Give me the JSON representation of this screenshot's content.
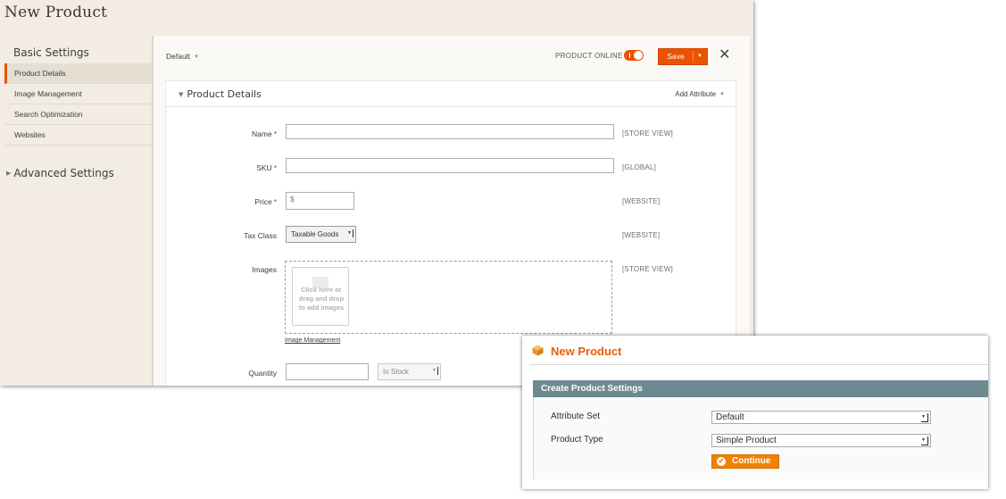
{
  "main": {
    "page_title": "New Product",
    "sidebar": {
      "basic_settings": "Basic Settings",
      "items": [
        "Product Details",
        "Image Management",
        "Search Optimization",
        "Websites"
      ],
      "advanced_settings": "Advanced Settings"
    },
    "toolbar": {
      "store_view": "Default",
      "product_online_label": "PRODUCT ONLINE",
      "product_online": true,
      "save_label": "Save"
    },
    "panel": {
      "title": "Product Details",
      "add_attribute": "Add Attribute",
      "fields": {
        "name": {
          "label": "Name",
          "required": "*",
          "value": "",
          "scope": "[STORE VIEW]"
        },
        "sku": {
          "label": "SKU",
          "required": "*",
          "value": "",
          "scope": "[GLOBAL]"
        },
        "price": {
          "label": "Price",
          "required": "*",
          "currency": "$",
          "scope": "[WEBSITE]"
        },
        "tax_class": {
          "label": "Tax Class",
          "value": "Taxable Goods",
          "scope": "[WEBSITE]"
        },
        "images": {
          "label": "Images",
          "dropzone_text": "Click here or drag and drop to add images",
          "scope": "[STORE VIEW]",
          "image_management_link": "Image Management"
        },
        "quantity": {
          "label": "Quantity",
          "value": "",
          "stock_status": "In Stock"
        }
      }
    }
  },
  "popup": {
    "title": "New Product",
    "section_title": "Create Product Settings",
    "attribute_set_label": "Attribute Set",
    "attribute_set_value": "Default",
    "product_type_label": "Product Type",
    "product_type_value": "Simple Product",
    "continue_label": "Continue"
  },
  "colors": {
    "accent": "#eb5202",
    "popup_title": "#eb5e00",
    "popup_bar": "#6f8992",
    "continue_button": "#f18200"
  }
}
